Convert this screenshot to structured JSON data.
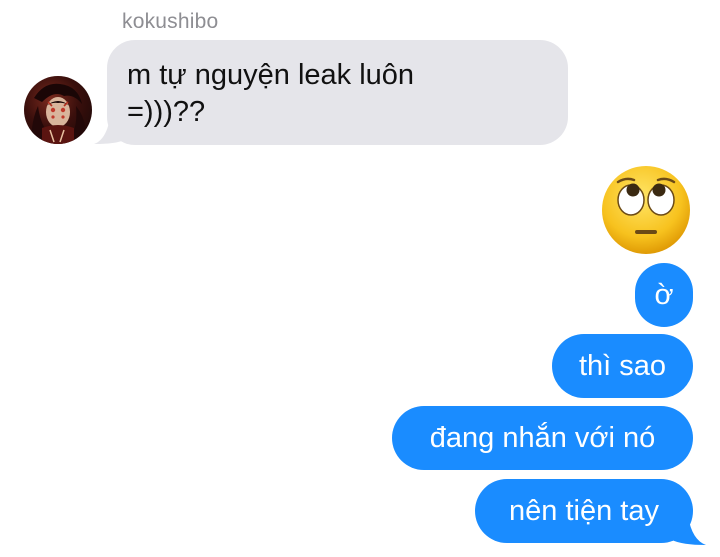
{
  "conversation": {
    "sender": "kokushibo",
    "incoming_message": "m tự nguyện leak luôn\n=)))??",
    "reaction_emoji": "🙄",
    "outgoing_messages": [
      "ờ",
      "thì sao",
      "đang nhắn với nó",
      "nên tiện tay"
    ]
  },
  "colors": {
    "incoming_bubble": "#e5e5ea",
    "outgoing_bubble": "#1a8cff",
    "sender_name": "#8e8e93"
  }
}
